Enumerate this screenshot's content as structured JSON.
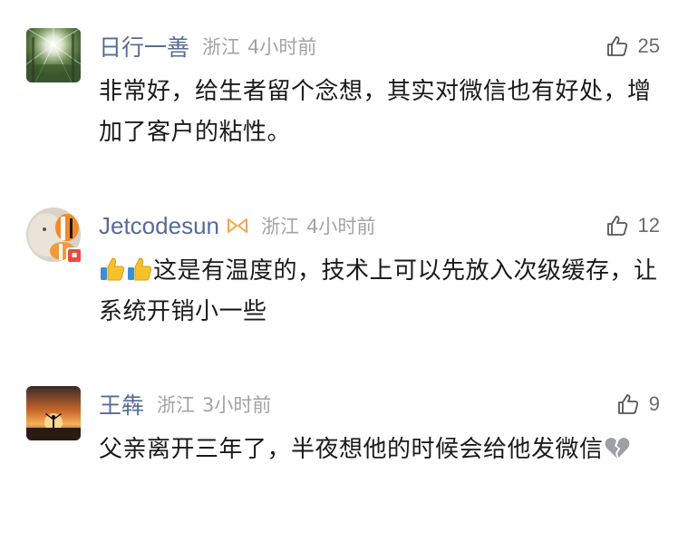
{
  "comments": [
    {
      "name": "日行一善",
      "location": "浙江",
      "time": "4小时前",
      "likes": "25",
      "text": "非常好，给生者留个念想，其实对微信也有好处，增加了客户的粘性。"
    },
    {
      "name": "Jetcodesun",
      "location": "浙江",
      "time": "4小时前",
      "likes": "12",
      "emoji_prefix": [
        "thumbs-up-icon",
        "thumbs-up-icon"
      ],
      "text": "这是有温度的，技术上可以先放入次级缓存，让系统开销小一些"
    },
    {
      "name": "王犇",
      "location": "浙江",
      "time": "3小时前",
      "likes": "9",
      "text": "父亲离开三年了，半夜想他的时候会给他发微信",
      "emoji_suffix": [
        "broken-heart-icon"
      ]
    }
  ],
  "colors": {
    "name": "#576b95",
    "meta": "#a3a3a3",
    "text": "#1a1a1a"
  }
}
